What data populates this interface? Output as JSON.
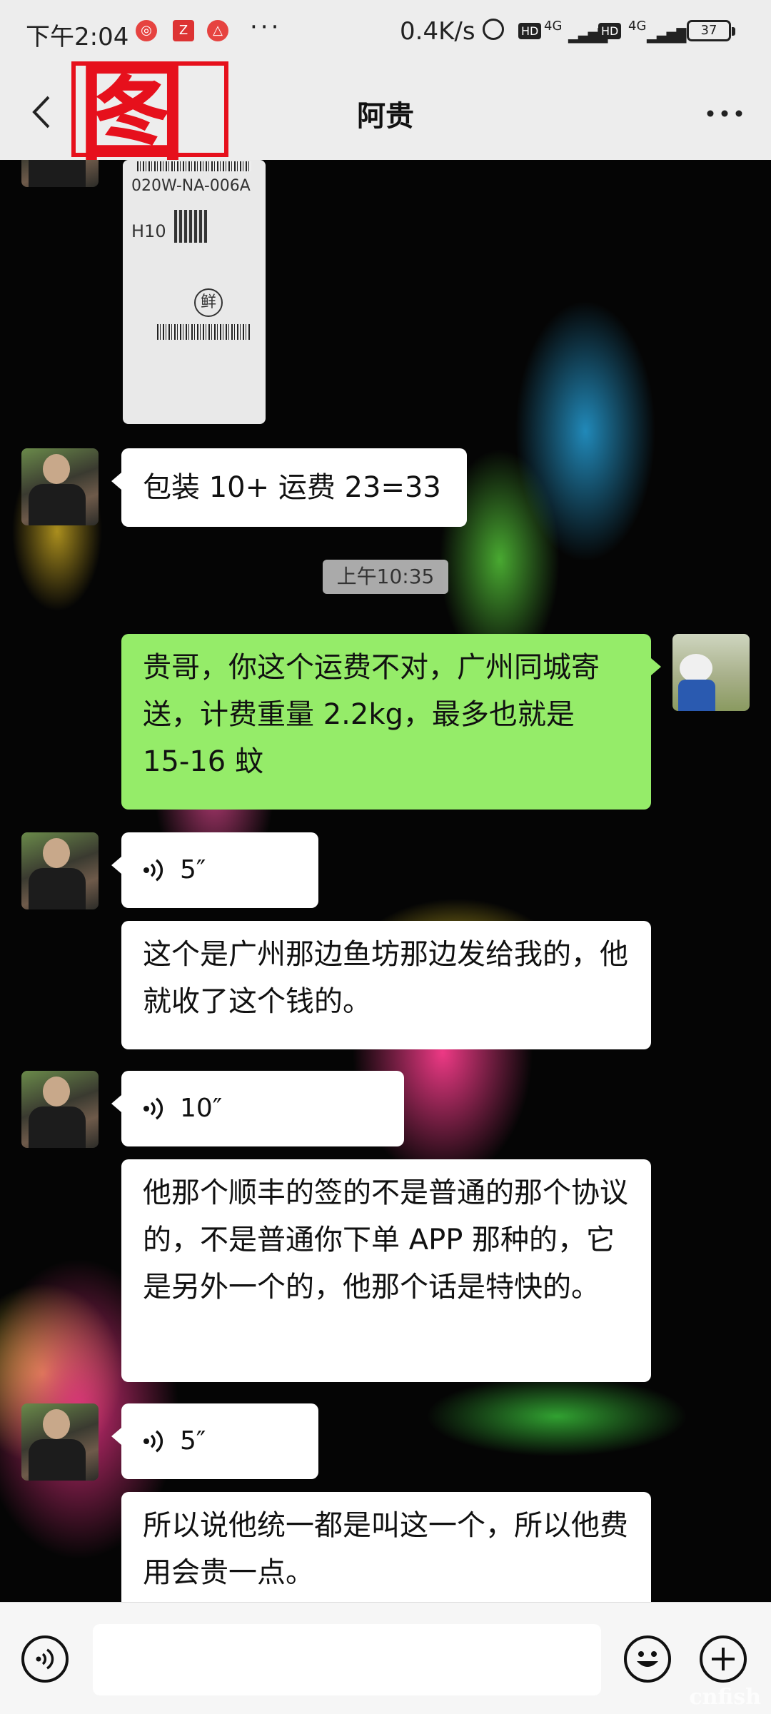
{
  "status_bar": {
    "time": "下午2:04",
    "more": "···",
    "net_speed": "0.4K/s",
    "hd": "HD",
    "signal_1": "4G",
    "signal_2": "4G",
    "battery": "37"
  },
  "header": {
    "overlay_label": "图4",
    "title": "阿贵"
  },
  "messages": [
    {
      "side": "left",
      "type": "text",
      "text": "包装 10+ 运费 23=33"
    },
    {
      "side": "center",
      "type": "time",
      "text": "上午10:35"
    },
    {
      "side": "right",
      "type": "text",
      "text": "贵哥，你这个运费不对，广州同城寄送，计费重量 2.2kg，最多也就是 15-16 蚊"
    },
    {
      "side": "left",
      "type": "voice",
      "text": "5″"
    },
    {
      "side": "left",
      "type": "text",
      "text": "这个是广州那边鱼坊那边发给我的，他就收了这个钱的。"
    },
    {
      "side": "left",
      "type": "voice",
      "text": "10″"
    },
    {
      "side": "left",
      "type": "text",
      "text": "他那个顺丰的签的不是普通的那个协议的，不是普通你下单 APP 那种的，它是另外一个的，他那个话是特快的。"
    },
    {
      "side": "left",
      "type": "voice",
      "text": "5″"
    },
    {
      "side": "left",
      "type": "text",
      "text": "所以说他统一都是叫这一个，所以他费用会贵一点。"
    }
  ],
  "package_label": {
    "code": "020W-NA-006A",
    "station": "H10",
    "fresh": "鲜"
  },
  "input_bar": {
    "placeholder": ""
  },
  "watermark": "cnfish"
}
